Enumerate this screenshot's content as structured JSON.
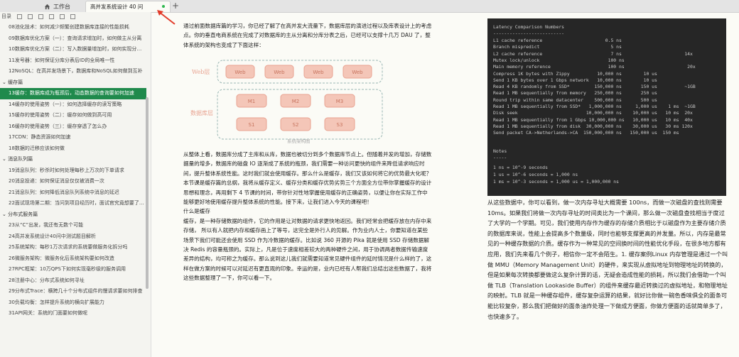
{
  "tabs": {
    "home_label": "工作台",
    "active_label": "高并发系统设计 40 问",
    "new_tab": "+"
  },
  "sidebar": {
    "header_label": "目录",
    "items": [
      {
        "label": "08池化技术：如何减少频繁创建数据库连接的性能损耗",
        "type": "item"
      },
      {
        "label": "09数据库优化方案（一）：查询请求增加时，如何做主从分离",
        "type": "item"
      },
      {
        "label": "10数据库优化方案（二）：写入数据量增加时，如何实现分库分表",
        "type": "item"
      },
      {
        "label": "11发号器：如何保证分库分表后ID的全局唯一性",
        "type": "item"
      },
      {
        "label": "12NoSQL：在高并发场景下，数据库和NoSQL如何做到互补",
        "type": "item"
      },
      {
        "label": "缓存篇",
        "type": "sec"
      },
      {
        "label": "13缓存：数据库成为瓶颈后，动态数据的查询要如何加速",
        "type": "active"
      },
      {
        "label": "14缓存的使用姿势（一）：如何选择缓存的读写策略",
        "type": "item"
      },
      {
        "label": "15缓存的使用姿势（二）：缓存如何做到高可用",
        "type": "item"
      },
      {
        "label": "16缓存的使用姿势（三）：缓存穿透了怎么办",
        "type": "item"
      },
      {
        "label": "17CDN：静态资源如何加速",
        "type": "item"
      },
      {
        "label": "18数据的迁移应该如何做",
        "type": "item"
      },
      {
        "label": "消息队列篇",
        "type": "sec"
      },
      {
        "label": "19消息队列：秒杀时如何处理每秒上万次的下单请求",
        "type": "item"
      },
      {
        "label": "20消息投递：如何保证消息仅仅被消费一次",
        "type": "item"
      },
      {
        "label": "21消息队列：如何降低消息队列系统中消息的延迟",
        "type": "item"
      },
      {
        "label": "22面试现场第二期：当问到项目经历时，面试官究竟想要了解什么",
        "type": "item"
      },
      {
        "label": "分布式服务篇",
        "type": "sec"
      },
      {
        "label": "23从“C”出发，我还有无数个可能",
        "type": "item"
      },
      {
        "label": "24高并发系统设计40问中测试题目解析",
        "type": "item"
      },
      {
        "label": "25系统架构：每秒1万次请求的系统要做服务化拆分吗",
        "type": "item"
      },
      {
        "label": "26微服务架构：微服务化后系统架构要如何改造",
        "type": "item"
      },
      {
        "label": "27RPC框架：10万QPS下如何实现毫秒级的服务调用",
        "type": "item"
      },
      {
        "label": "28注册中心：分布式系统如何寻址",
        "type": "item"
      },
      {
        "label": "29分布式Trace：横跨几十个分布式组件的慢请求要如何排查",
        "type": "item"
      },
      {
        "label": "30负载均衡：怎样提升系统的横向扩展能力",
        "type": "item"
      },
      {
        "label": "31API网关：系统的门面要如何做呢",
        "type": "item"
      }
    ]
  },
  "article": {
    "intro": "通过前面数据库篇的学习，你已经了解了在高并发大流量下，数据库层的演进过程以及库表设计上的考虑点。你的垂直电商系统在完成了对数据库的主从分离和分库分表之后，已经可以支撑十几万 DAU 了，整体系统的架构也变成了下面这样：",
    "arch_web_label": "Web层",
    "arch_db_label": "数据库层",
    "arch_web_nodes": [
      "Web",
      "Web",
      "Web",
      "Web"
    ],
    "arch_master_nodes": [
      "M1",
      "M2",
      "M3"
    ],
    "arch_slave_nodes": [
      "S1",
      "S2",
      "S3"
    ],
    "caption": "系统架构图",
    "body": "从整体上看，数据库分成了主库和从库，数据也被切分到多个数据库节点上。但随着并发的增加，存储数据量的增多，数据库的磁盘 IO 逐渐成了系统的瓶颈，我们需要一种访问更快的组件来降低请求响应时间，提升整体系统性能。这时我们就会使用缓存。那么什么是缓存，我们又该如何将它的优势最大化呢？本节课是缓存篇的总纲，我将从缓存定义、缓存分类和缓存优势劣势三个方面全方位带你掌握缓存的设计思想和理念，再用剩下 4 节课的时间，带你针对性地掌握使用缓存的正确姿势，以便让你在实际工作中能够更好地使用缓存提升整体系统的性能。接下来，让我们进入今天的课程吧！",
    "subhead": "什么是缓存",
    "body2": "缓存，是一种存储数据的组件，它的作用是让对数据的请求更快地返回。我们经常会把缓存放在内存中来存储， 所以有人就把内存和缓存画上了等号，这完全是外行人的见解。作为业内人士，你要知道在某些场景下我们可能还会使用 SSD 作为冷数据的缓存。比如说 360 开源的 Pika 就是使用 SSD 存储数据解决 Redis 的容量瓶颈的。实际上，凡是位于速度相差较大的两种硬件之间，用于协调两者数据传输速度差异的结构，均可称之为缓存。那么说到这儿我们就需要知道常见硬件组件的延时情况是什么样的了，这样在做方案的时候可以对延迟有更直观的印象。幸运的是，业内已经有人帮我们总结出这些数据了，我将这些数据整理了一下，你可以看一下。"
  },
  "latency": {
    "title": "Latency Comparison Numbers",
    "divider": "--------------------------",
    "rows": [
      "L1 cache reference                       0.5 ns",
      "Branch mispredict                          5 ns",
      "L2 cache reference                         7 ns                       14x",
      "Mutex lock/unlock                         100 ns",
      "Main memory reference                     100 ns                       20x",
      "Compress 1K bytes with Zippy          10,000 ns        10 us",
      "Send 1 KB bytes over 1 Gbps network   10,000 ns        10 us",
      "Read 4 KB randomly from SSD*         150,000 ns       150 us          ~1GB",
      "Read 1 MB sequentially from memory   250,000 ns       250 us",
      "Round trip within same datacenter    500,000 ns       500 us",
      "Read 1 MB sequentially from SSD*   1,000,000 ns     1,000 us    1 ms  ~1GB",
      "Disk seek                         10,000,000 ns    10,000 us   10 ms  20x",
      "Read 1 MB sequentially from 1 Gbps 10,000,000 ns   10,000 us   10 ms  40x",
      "Read 1 MB sequentially from disk  30,000,000 ns    30,000 us   30 ms 120x",
      "Send packet CA->Netherlands->CA  150,000,000 ns   150,000 us  150 ms"
    ],
    "notes_title": "Notes",
    "notes_divider": "-----",
    "notes": [
      "1 ns = 10^-9 seconds",
      "1 us = 10^-6 seconds = 1,000 ns",
      "1 ms = 10^-3 seconds = 1,000 us = 1,000,000 ns"
    ]
  },
  "right_text": "从这些数据中，你可以看到，做一次内存寻址大概需要 100ns，而做一次磁盘的查找则需要 10ms。如果我们将做一次内存寻址的时间类比为一个课间，那么做一次磁盘查找相当于度过了大学的一个学期。可见，我们使用内存作为缓存的存储介质相比于以磁盘作为主要存储介质的数据库来说，性能上会提高多个数量级，同时也能够支撑更高的并发量。所以，内存是最常见的一种缓存数据的介质。缓存作为一种常见的空间换时间的性能优化手段，在很多地方都有应用，我们先来看几个例子，相信你一定不会陌生。1. 缓存案例Linux 内存管理是通过一个叫做 MMU（Memory Management Unit）的硬件，来实现从虚拟地址到物理地址的转换的，但是如果每次转换都要做这么复杂计算的话，无疑会造成性能的损耗，所以我们会借助一个叫做 TLB（Translation Lookaside Buffer）的组件来缓存最近转换过的虚拟地址，和物理地址的映射。TLB 就是一种缓存组件，缓存复杂运算的结果，就好比你做一碗色香味俱全的面条可能比较复杂，那么我们把做好的面条油炸处理一下做成方便面，你做方便面的话就简单多了，也快速多了。"
}
